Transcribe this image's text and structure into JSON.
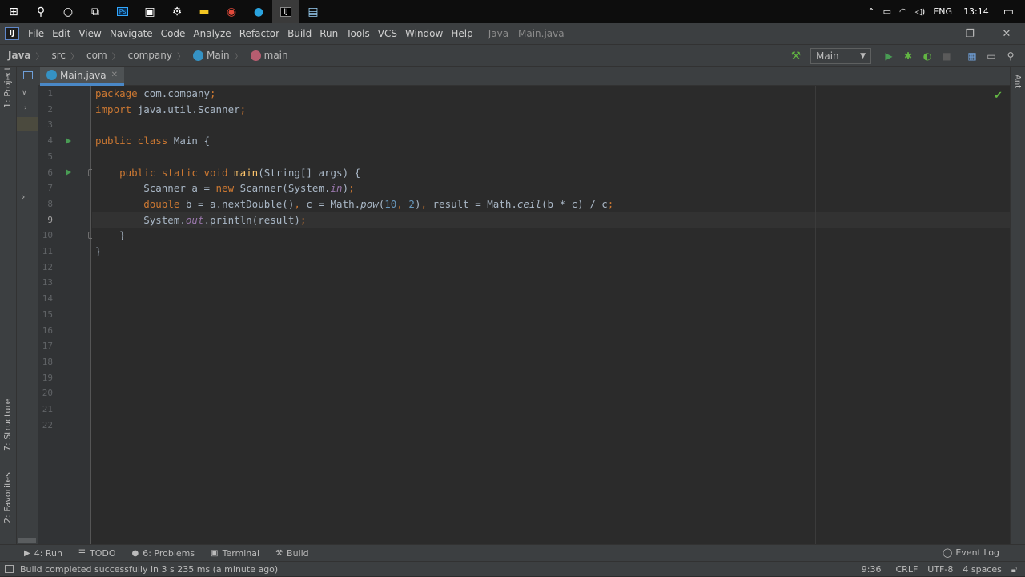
{
  "taskbar": {
    "icons": [
      "windows-start-icon",
      "search-icon",
      "cortana-icon",
      "task-view-icon",
      "photoshop-icon",
      "store-icon",
      "settings-icon",
      "file-explorer-icon",
      "chrome-icon",
      "telegram-icon",
      "intellij-icon",
      "notepad-icon"
    ],
    "language": "ENG",
    "time": "13:14"
  },
  "menubar": {
    "items": [
      {
        "label": "File",
        "mnemonic": "F",
        "rest": "ile"
      },
      {
        "label": "Edit",
        "mnemonic": "E",
        "rest": "dit"
      },
      {
        "label": "View",
        "mnemonic": "V",
        "rest": "iew"
      },
      {
        "label": "Navigate",
        "mnemonic": "N",
        "rest": "avigate"
      },
      {
        "label": "Code",
        "mnemonic": "C",
        "rest": "ode"
      },
      {
        "label": "Analyze",
        "mnemonic": "",
        "rest": "Analyze"
      },
      {
        "label": "Refactor",
        "mnemonic": "R",
        "rest": "efactor"
      },
      {
        "label": "Build",
        "mnemonic": "B",
        "rest": "uild"
      },
      {
        "label": "Run",
        "mnemonic": "",
        "rest": "Run"
      },
      {
        "label": "Tools",
        "mnemonic": "T",
        "rest": "ools"
      },
      {
        "label": "VCS",
        "mnemonic": "",
        "rest": "VCS"
      },
      {
        "label": "Window",
        "mnemonic": "W",
        "rest": "indow"
      },
      {
        "label": "Help",
        "mnemonic": "H",
        "rest": "elp"
      }
    ],
    "window_title": "Java - Main.java"
  },
  "breadcrumbs": {
    "project": "Java",
    "items": [
      "src",
      "com",
      "company",
      "Main",
      "main"
    ]
  },
  "toolbar": {
    "run_config": "Main"
  },
  "sidebar": {
    "project_label": "1: Project",
    "structure_label": "7: Structure",
    "favorites_label": "2: Favorites",
    "ant_label": "Ant"
  },
  "tab": {
    "label": "Main.java"
  },
  "editor": {
    "current_line": 9,
    "line_count": 22
  },
  "bottom_tools": {
    "run": "4: Run",
    "todo": "TODO",
    "problems": "6: Problems",
    "terminal": "Terminal",
    "build": "Build",
    "event_log": "Event Log"
  },
  "status": {
    "message": "Build completed successfully in 3 s 235 ms (a minute ago)",
    "position": "9:36",
    "line_sep": "CRLF",
    "encoding": "UTF-8",
    "indent": "4 spaces"
  }
}
